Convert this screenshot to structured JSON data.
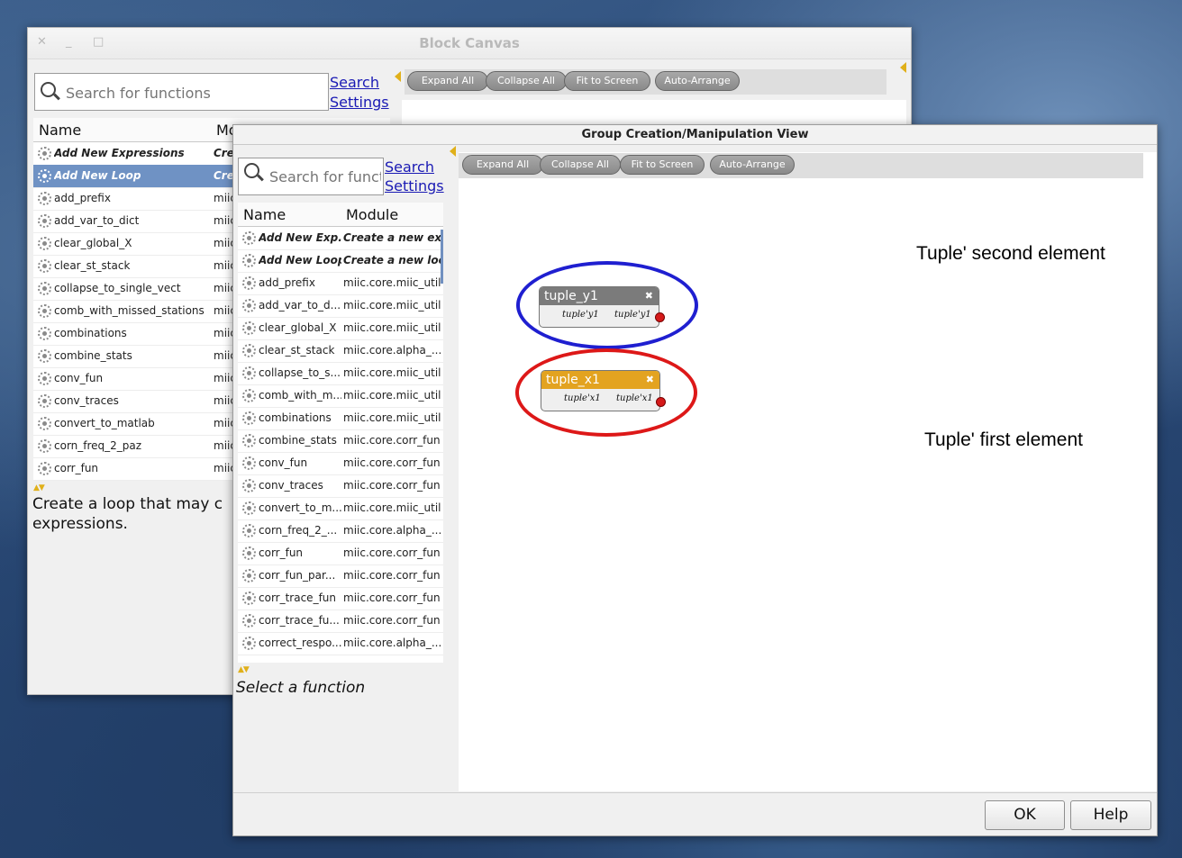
{
  "main_window": {
    "title": "Block Canvas",
    "close_glyph": "✕",
    "minimize_glyph": "_",
    "maximize_glyph": "□",
    "search_placeholder": "Search for functions",
    "search_label": "Search",
    "settings_label": "Settings",
    "columns": [
      "Name",
      "Mo"
    ],
    "rows": [
      {
        "name": "Add New Expressions",
        "module": "Cre",
        "bold": true
      },
      {
        "name": "Add New Loop",
        "module": "Cre",
        "bold": true,
        "selected": true
      },
      {
        "name": "add_prefix",
        "module": "miic"
      },
      {
        "name": "add_var_to_dict",
        "module": "miic"
      },
      {
        "name": "clear_global_X",
        "module": "miic"
      },
      {
        "name": "clear_st_stack",
        "module": "miic"
      },
      {
        "name": "collapse_to_single_vect",
        "module": "miic"
      },
      {
        "name": "comb_with_missed_stations",
        "module": "miic"
      },
      {
        "name": "combinations",
        "module": "miic"
      },
      {
        "name": "combine_stats",
        "module": "miic"
      },
      {
        "name": "conv_fun",
        "module": "miic"
      },
      {
        "name": "conv_traces",
        "module": "miic"
      },
      {
        "name": "convert_to_matlab",
        "module": "miic"
      },
      {
        "name": "corn_freq_2_paz",
        "module": "miic"
      },
      {
        "name": "corr_fun",
        "module": "miic"
      }
    ],
    "description_line1": "Create a loop that may c",
    "description_line2": "expressions.",
    "toolbar": [
      "Expand All",
      "Collapse All",
      "Fit to Screen",
      "Auto-Arrange"
    ]
  },
  "group_window": {
    "title": "Group Creation/Manipulation View",
    "search_placeholder": "Search for funct",
    "search_label": "Search",
    "settings_label": "Settings",
    "columns": [
      "Name",
      "Module"
    ],
    "rows": [
      {
        "name": "Add New Exp...",
        "module": "Create a new ex...",
        "bold": true
      },
      {
        "name": "Add New Loop",
        "module": "Create a new loo...",
        "bold": true
      },
      {
        "name": "add_prefix",
        "module": "miic.core.miic_utils"
      },
      {
        "name": "add_var_to_d...",
        "module": "miic.core.miic_utils"
      },
      {
        "name": "clear_global_X",
        "module": "miic.core.miic_utils"
      },
      {
        "name": "clear_st_stack",
        "module": "miic.core.alpha_..."
      },
      {
        "name": "collapse_to_s...",
        "module": "miic.core.miic_utils"
      },
      {
        "name": "comb_with_m...",
        "module": "miic.core.miic_utils"
      },
      {
        "name": "combinations",
        "module": "miic.core.miic_utils"
      },
      {
        "name": "combine_stats",
        "module": "miic.core.corr_fun"
      },
      {
        "name": "conv_fun",
        "module": "miic.core.corr_fun"
      },
      {
        "name": "conv_traces",
        "module": "miic.core.corr_fun"
      },
      {
        "name": "convert_to_m...",
        "module": "miic.core.miic_utils"
      },
      {
        "name": "corn_freq_2_...",
        "module": "miic.core.alpha_..."
      },
      {
        "name": "corr_fun",
        "module": "miic.core.corr_fun"
      },
      {
        "name": "corr_fun_par...",
        "module": "miic.core.corr_fun"
      },
      {
        "name": "corr_trace_fun",
        "module": "miic.core.corr_fun"
      },
      {
        "name": "corr_trace_fu...",
        "module": "miic.core.corr_fun"
      },
      {
        "name": "correct_respo...",
        "module": "miic.core.alpha_..."
      }
    ],
    "description": "Select a function",
    "toolbar": [
      "Expand All",
      "Collapse All",
      "Fit to Screen",
      "Auto-Arrange"
    ],
    "nodes": [
      {
        "title": "tuple_y1",
        "in_port": "tuple'y1",
        "out_port": "tuple'y1",
        "color": "#7b7b7b"
      },
      {
        "title": "tuple_x1",
        "in_port": "tuple'x1",
        "out_port": "tuple'x1",
        "color": "#e3a320"
      }
    ],
    "annotations": {
      "second": "Tuple' second element",
      "first": "Tuple' first element",
      "second_color": "#1f1fd0",
      "first_color": "#dd1818"
    },
    "buttons": {
      "ok": "OK",
      "help": "Help"
    },
    "node_close_glyph": "✖"
  }
}
